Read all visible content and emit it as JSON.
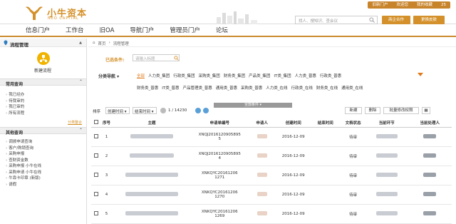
{
  "brand": {
    "name_cn": "小牛资本",
    "name_en": "NEO CAPITAL"
  },
  "toplinks": [
    "旧新门户",
    "欢迎您",
    "我的收藏",
    "25"
  ],
  "nav": [
    "信息门户",
    "工作台",
    "旧OA",
    "导航门户",
    "管理员门户",
    "论坛"
  ],
  "search": {
    "placeholder": "找人、搜知识、查会议"
  },
  "header_buttons": {
    "quick": "商企合作",
    "skin": "更换皮肤"
  },
  "sidebar": {
    "title": "流程管理",
    "new_flow": "新建流程",
    "common_query": "常用查询",
    "common_items": [
      "我已经办",
      "待我审的",
      "我已审的",
      "所有流程"
    ],
    "customize": "分类整合",
    "other_query": "其他查询",
    "other_items": [
      "调拨申请查询",
      "客户/购销查询",
      "采购申报",
      "查财资金数",
      "采购申报 小牛在线",
      "采购申请 小牛在线",
      "牛靠卡印章 (新版)",
      "请假"
    ]
  },
  "breadcrumb": [
    "首页",
    "流程管理"
  ],
  "filters": {
    "chosen_label": "已选条件:",
    "input_placeholder": "请输入标题",
    "category_label": "分类导航",
    "row1": [
      "全部",
      "人力类_集团",
      "行政类_集团",
      "采购类_集团",
      "财务类_集团",
      "产品类_集团",
      "IT类_集团",
      "人力类_普惠",
      "行政类_普惠"
    ],
    "row2": [
      "财务类_普惠",
      "IT类_普惠",
      "产品管理类_普惠",
      "通用类_普惠",
      "采购类_普惠",
      "人力类_在线",
      "行政类_在线",
      "财务类_在线",
      "通用类_在线"
    ],
    "collapse": "全部条件"
  },
  "toolbar": {
    "sort_label": "排序",
    "sort1": "创建时间 ▾",
    "sort2": "结束时间 ▾",
    "page": "1 / 14230",
    "btn_new": "新建",
    "btn_delete": "删除",
    "btn_batch": "批量修改权限"
  },
  "table": {
    "headers": [
      "序号",
      "主题",
      "申请单编号",
      "申请人",
      "创建时间",
      "结束时间",
      "文档状态",
      "当前环节",
      "当前处理人"
    ],
    "rows": [
      {
        "no": "1",
        "code1": "XNQJ2016120905895",
        "code2": "5",
        "date": "2016-12-09",
        "status": "待审"
      },
      {
        "no": "2",
        "code1": "XNQJ2016120905895",
        "code2": "4",
        "date": "2016-12-09",
        "status": "待审"
      },
      {
        "no": "3",
        "code1": "XNKQYC20161206",
        "code2": "1271",
        "date": "2016-12-09",
        "status": "待审"
      },
      {
        "no": "4",
        "code1": "XNKQYC20161206",
        "code2": "1270",
        "date": "2016-12-09",
        "status": "待审"
      },
      {
        "no": "5",
        "code1": "XNKQYC20161206",
        "code2": "1269",
        "date": "2016-12-09",
        "status": "待审"
      }
    ]
  },
  "colors": {
    "accent": "#d4912b",
    "active": "#e07a1a"
  }
}
